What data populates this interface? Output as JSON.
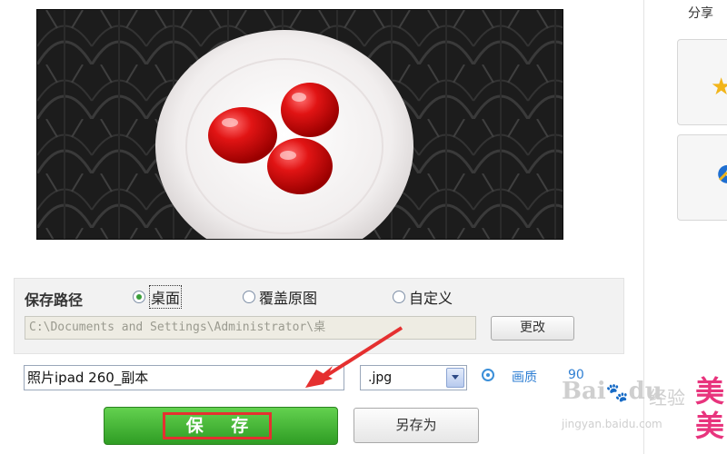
{
  "preview": {
    "image_description_icon": "photo-tomatoes-on-plate"
  },
  "save_panel": {
    "path_label": "保存路径",
    "options": [
      {
        "label": "桌面",
        "selected": true
      },
      {
        "label": "覆盖原图",
        "selected": false
      },
      {
        "label": "自定义",
        "selected": false
      }
    ],
    "path_value": "C:\\Documents and Settings\\Administrator\\桌",
    "change_label": "更改"
  },
  "filename": {
    "value": "照片ipad 260_副本",
    "extension": ".jpg"
  },
  "quality": {
    "label": "画质",
    "value": "90"
  },
  "buttons": {
    "save_label": "保 存",
    "save_as_label": "另存为"
  },
  "share": {
    "label": "分享"
  },
  "watermark": {
    "brand": "Bai",
    "paw": "du",
    "sub": "经验",
    "url": "jingyan.baidu.com"
  },
  "promo": {
    "text": "美美"
  },
  "colors": {
    "save_green": "#3fb22f",
    "annotation_red": "#e53030",
    "link_blue": "#2f7fd3",
    "promo_pink": "#e8347d"
  }
}
